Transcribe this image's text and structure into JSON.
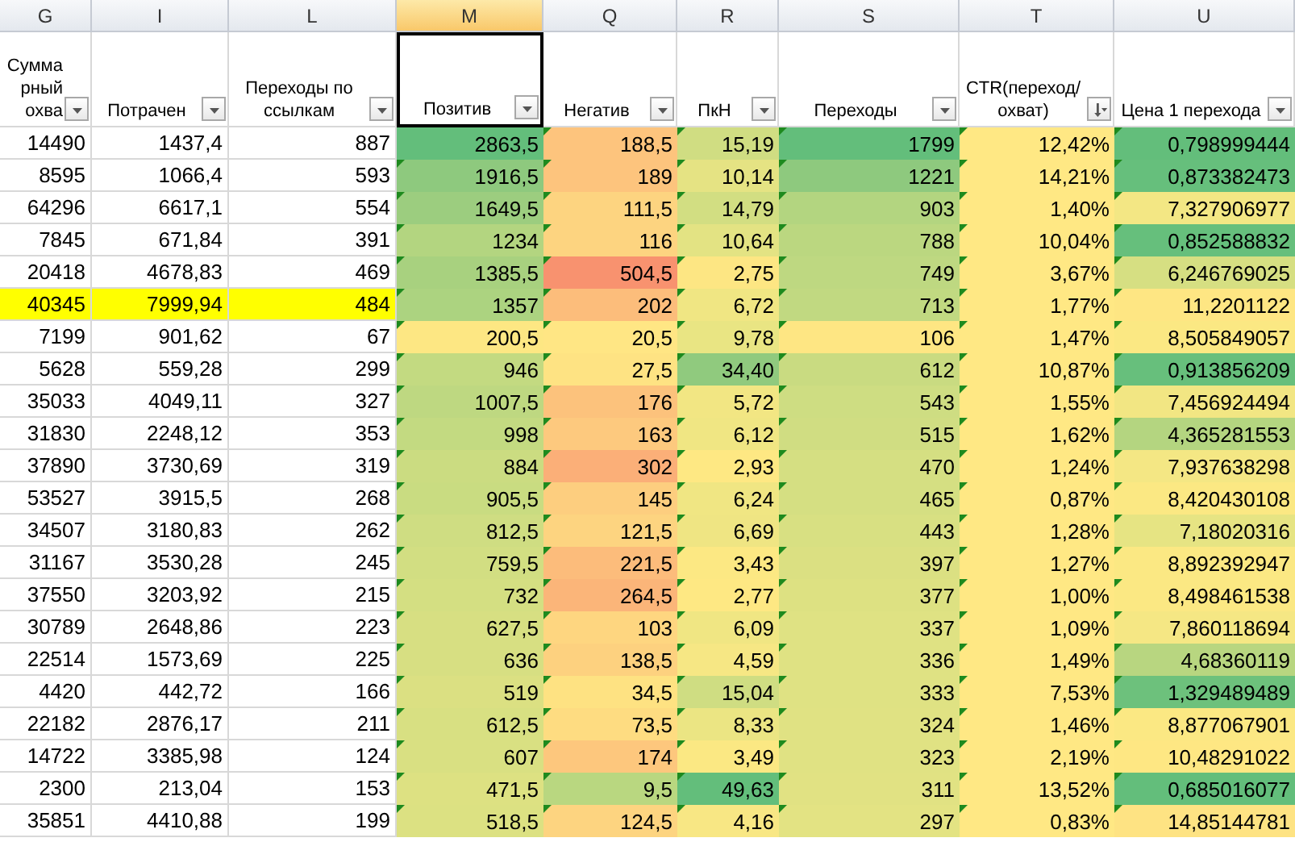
{
  "columns": [
    {
      "letter": "G",
      "header": "Суммарный охва",
      "sorted": false,
      "selected": false
    },
    {
      "letter": "I",
      "header": "Потрачен",
      "sorted": false,
      "selected": false
    },
    {
      "letter": "L",
      "header": "Переходы по ссылкам",
      "sorted": false,
      "selected": false
    },
    {
      "letter": "M",
      "header": "Позитив",
      "sorted": false,
      "selected": true
    },
    {
      "letter": "Q",
      "header": "Негатив",
      "sorted": false,
      "selected": false
    },
    {
      "letter": "R",
      "header": "ПкН",
      "sorted": false,
      "selected": false
    },
    {
      "letter": "S",
      "header": "Переходы",
      "sorted": false,
      "selected": false
    },
    {
      "letter": "T",
      "header": "CTR(переход/ охват)",
      "sorted": true,
      "selected": false
    },
    {
      "letter": "U",
      "header": "Цена 1 перехода",
      "sorted": false,
      "selected": false
    }
  ],
  "rows": [
    {
      "highlighted": false,
      "cells": [
        {
          "text": "14490"
        },
        {
          "text": "1437,4"
        },
        {
          "text": "887"
        },
        {
          "text": "2863,5",
          "color": "#63be7b",
          "flagged": false
        },
        {
          "text": "188,5",
          "color": "#fdc47d",
          "flagged": true
        },
        {
          "text": "15,19",
          "color": "#d0dd82",
          "flagged": true
        },
        {
          "text": "1799",
          "color": "#63be7b",
          "flagged": true
        },
        {
          "text": "12,42%",
          "color": "#ffe884",
          "flagged": true
        },
        {
          "text": "0,798999444",
          "color": "#63be7b",
          "flagged": true
        }
      ]
    },
    {
      "highlighted": false,
      "cells": [
        {
          "text": "8595"
        },
        {
          "text": "1066,4"
        },
        {
          "text": "593"
        },
        {
          "text": "1916,5",
          "color": "#8ec97e",
          "flagged": true
        },
        {
          "text": "189",
          "color": "#fdc47d",
          "flagged": true
        },
        {
          "text": "10,14",
          "color": "#e5e383",
          "flagged": true
        },
        {
          "text": "1221",
          "color": "#8ec97e",
          "flagged": true
        },
        {
          "text": "14,21%",
          "color": "#ffe884",
          "flagged": true
        },
        {
          "text": "0,873382473",
          "color": "#66bf7c",
          "flagged": true
        }
      ]
    },
    {
      "highlighted": false,
      "cells": [
        {
          "text": "64296"
        },
        {
          "text": "6617,1"
        },
        {
          "text": "554"
        },
        {
          "text": "1649,5",
          "color": "#9ccd7f",
          "flagged": true
        },
        {
          "text": "111,5",
          "color": "#fdd480",
          "flagged": true
        },
        {
          "text": "14,79",
          "color": "#d2de82",
          "flagged": true
        },
        {
          "text": "903",
          "color": "#b3d580",
          "flagged": true
        },
        {
          "text": "1,40%",
          "color": "#ffe884",
          "flagged": true
        },
        {
          "text": "7,327906977",
          "color": "#f3e784",
          "flagged": true
        }
      ]
    },
    {
      "highlighted": false,
      "cells": [
        {
          "text": "7845"
        },
        {
          "text": "671,84"
        },
        {
          "text": "391"
        },
        {
          "text": "1234",
          "color": "#b3d580",
          "flagged": true
        },
        {
          "text": "116",
          "color": "#fdd480",
          "flagged": true
        },
        {
          "text": "10,64",
          "color": "#e3e383",
          "flagged": true
        },
        {
          "text": "788",
          "color": "#bbd780",
          "flagged": true
        },
        {
          "text": "10,04%",
          "color": "#ffe884",
          "flagged": true
        },
        {
          "text": "0,852588832",
          "color": "#66bf7c",
          "flagged": true
        }
      ]
    },
    {
      "highlighted": false,
      "cells": [
        {
          "text": "20418"
        },
        {
          "text": "4678,83"
        },
        {
          "text": "469"
        },
        {
          "text": "1385,5",
          "color": "#a8d17f",
          "flagged": true
        },
        {
          "text": "504,5",
          "color": "#f8926f",
          "flagged": true
        },
        {
          "text": "2,75",
          "color": "#fde683",
          "flagged": true
        },
        {
          "text": "749",
          "color": "#bed881",
          "flagged": true
        },
        {
          "text": "3,67%",
          "color": "#ffe884",
          "flagged": true
        },
        {
          "text": "6,246769025",
          "color": "#d6df82",
          "flagged": true
        }
      ]
    },
    {
      "highlighted": true,
      "cells": [
        {
          "text": "40345"
        },
        {
          "text": "7999,94"
        },
        {
          "text": "484"
        },
        {
          "text": "1357",
          "color": "#acd380",
          "flagged": true
        },
        {
          "text": "202",
          "color": "#fcbd7b",
          "flagged": true
        },
        {
          "text": "6,72",
          "color": "#f0e683",
          "flagged": true
        },
        {
          "text": "713",
          "color": "#c1d981",
          "flagged": true
        },
        {
          "text": "1,77%",
          "color": "#ffe884",
          "flagged": true
        },
        {
          "text": "11,2201122",
          "color": "#fee683",
          "flagged": true
        }
      ]
    },
    {
      "highlighted": false,
      "cells": [
        {
          "text": "7199"
        },
        {
          "text": "901,62"
        },
        {
          "text": "67"
        },
        {
          "text": "200,5",
          "color": "#fde783",
          "flagged": true
        },
        {
          "text": "20,5",
          "color": "#ffe684",
          "flagged": true
        },
        {
          "text": "9,78",
          "color": "#e9e583",
          "flagged": true
        },
        {
          "text": "106",
          "color": "#fee683",
          "flagged": true
        },
        {
          "text": "1,47%",
          "color": "#ffe884",
          "flagged": true
        },
        {
          "text": "8,505849057",
          "color": "#fbe883",
          "flagged": true
        }
      ]
    },
    {
      "highlighted": false,
      "cells": [
        {
          "text": "5628"
        },
        {
          "text": "559,28"
        },
        {
          "text": "299"
        },
        {
          "text": "946",
          "color": "#c3da81",
          "flagged": true
        },
        {
          "text": "27,5",
          "color": "#fee383",
          "flagged": true
        },
        {
          "text": "34,40",
          "color": "#90ca7e",
          "flagged": true
        },
        {
          "text": "612",
          "color": "#c9db81",
          "flagged": true
        },
        {
          "text": "10,87%",
          "color": "#ffe884",
          "flagged": true
        },
        {
          "text": "0,913856209",
          "color": "#67bf7c",
          "flagged": true
        }
      ]
    },
    {
      "highlighted": false,
      "cells": [
        {
          "text": "35033"
        },
        {
          "text": "4049,11"
        },
        {
          "text": "327"
        },
        {
          "text": "1007,5",
          "color": "#bed881",
          "flagged": true
        },
        {
          "text": "176",
          "color": "#fcc27c",
          "flagged": true
        },
        {
          "text": "5,72",
          "color": "#f2e683",
          "flagged": true
        },
        {
          "text": "543",
          "color": "#cedd82",
          "flagged": true
        },
        {
          "text": "1,55%",
          "color": "#ffe884",
          "flagged": true
        },
        {
          "text": "7,456924494",
          "color": "#f2e683",
          "flagged": true
        }
      ]
    },
    {
      "highlighted": false,
      "cells": [
        {
          "text": "31830"
        },
        {
          "text": "2248,12"
        },
        {
          "text": "353"
        },
        {
          "text": "998",
          "color": "#c3da81",
          "flagged": true
        },
        {
          "text": "163",
          "color": "#fdc97e",
          "flagged": true
        },
        {
          "text": "6,12",
          "color": "#f0e683",
          "flagged": true
        },
        {
          "text": "515",
          "color": "#d0dd82",
          "flagged": true
        },
        {
          "text": "1,62%",
          "color": "#ffe884",
          "flagged": true
        },
        {
          "text": "4,365281553",
          "color": "#b4d580",
          "flagged": true
        }
      ]
    },
    {
      "highlighted": false,
      "cells": [
        {
          "text": "37890"
        },
        {
          "text": "3730,69"
        },
        {
          "text": "319"
        },
        {
          "text": "884",
          "color": "#cbdc81",
          "flagged": true
        },
        {
          "text": "302",
          "color": "#fbaf78",
          "flagged": true
        },
        {
          "text": "2,93",
          "color": "#fee883",
          "flagged": true
        },
        {
          "text": "470",
          "color": "#d5df82",
          "flagged": true
        },
        {
          "text": "1,24%",
          "color": "#ffe884",
          "flagged": true
        },
        {
          "text": "7,937638298",
          "color": "#f4e784",
          "flagged": true
        }
      ]
    },
    {
      "highlighted": false,
      "cells": [
        {
          "text": "53527"
        },
        {
          "text": "3915,5"
        },
        {
          "text": "268"
        },
        {
          "text": "905,5",
          "color": "#c9dc81",
          "flagged": true
        },
        {
          "text": "145",
          "color": "#fdce7f",
          "flagged": true
        },
        {
          "text": "6,24",
          "color": "#f0e683",
          "flagged": true
        },
        {
          "text": "465",
          "color": "#d5df82",
          "flagged": true
        },
        {
          "text": "0,87%",
          "color": "#ffe884",
          "flagged": true
        },
        {
          "text": "8,420430108",
          "color": "#fbe883",
          "flagged": true
        }
      ]
    },
    {
      "highlighted": false,
      "cells": [
        {
          "text": "34507"
        },
        {
          "text": "3180,83"
        },
        {
          "text": "262"
        },
        {
          "text": "812,5",
          "color": "#cfdd82",
          "flagged": true
        },
        {
          "text": "121,5",
          "color": "#fdd480",
          "flagged": true
        },
        {
          "text": "6,69",
          "color": "#efe583",
          "flagged": true
        },
        {
          "text": "443",
          "color": "#d8e082",
          "flagged": true
        },
        {
          "text": "1,28%",
          "color": "#ffe884",
          "flagged": true
        },
        {
          "text": "7,18020316",
          "color": "#e6e483",
          "flagged": true
        }
      ]
    },
    {
      "highlighted": false,
      "cells": [
        {
          "text": "31167"
        },
        {
          "text": "3530,28"
        },
        {
          "text": "245"
        },
        {
          "text": "759,5",
          "color": "#d2de82",
          "flagged": true
        },
        {
          "text": "221,5",
          "color": "#fcbc7b",
          "flagged": true
        },
        {
          "text": "3,43",
          "color": "#fce883",
          "flagged": true
        },
        {
          "text": "397",
          "color": "#dbe082",
          "flagged": true
        },
        {
          "text": "1,27%",
          "color": "#ffe884",
          "flagged": true
        },
        {
          "text": "8,892392947",
          "color": "#fbe883",
          "flagged": true
        }
      ]
    },
    {
      "highlighted": false,
      "cells": [
        {
          "text": "37550"
        },
        {
          "text": "3203,92"
        },
        {
          "text": "215"
        },
        {
          "text": "732",
          "color": "#d4df82",
          "flagged": true
        },
        {
          "text": "264,5",
          "color": "#fbb579",
          "flagged": true
        },
        {
          "text": "2,77",
          "color": "#fee883",
          "flagged": true
        },
        {
          "text": "377",
          "color": "#dde182",
          "flagged": true
        },
        {
          "text": "1,00%",
          "color": "#ffe884",
          "flagged": true
        },
        {
          "text": "8,498461538",
          "color": "#fbe883",
          "flagged": true
        }
      ]
    },
    {
      "highlighted": false,
      "cells": [
        {
          "text": "30789"
        },
        {
          "text": "2648,86"
        },
        {
          "text": "223"
        },
        {
          "text": "627,5",
          "color": "#d7df82",
          "flagged": true
        },
        {
          "text": "103",
          "color": "#fed680",
          "flagged": true
        },
        {
          "text": "6,09",
          "color": "#f0e683",
          "flagged": true
        },
        {
          "text": "337",
          "color": "#dfe283",
          "flagged": true
        },
        {
          "text": "1,09%",
          "color": "#ffe884",
          "flagged": true
        },
        {
          "text": "7,860118694",
          "color": "#f5e784",
          "flagged": true
        }
      ]
    },
    {
      "highlighted": false,
      "cells": [
        {
          "text": "22514"
        },
        {
          "text": "1573,69"
        },
        {
          "text": "225"
        },
        {
          "text": "636",
          "color": "#d7df82",
          "flagged": true
        },
        {
          "text": "138,5",
          "color": "#fdd17f",
          "flagged": true
        },
        {
          "text": "4,59",
          "color": "#f6e784",
          "flagged": true
        },
        {
          "text": "336",
          "color": "#dfe283",
          "flagged": true
        },
        {
          "text": "1,49%",
          "color": "#ffe884",
          "flagged": true
        },
        {
          "text": "4,68360119",
          "color": "#b8d680",
          "flagged": true
        }
      ]
    },
    {
      "highlighted": false,
      "cells": [
        {
          "text": "4420"
        },
        {
          "text": "442,72"
        },
        {
          "text": "166"
        },
        {
          "text": "519",
          "color": "#dbe082",
          "flagged": true
        },
        {
          "text": "34,5",
          "color": "#fee282",
          "flagged": true
        },
        {
          "text": "15,04",
          "color": "#cfdd82",
          "flagged": true
        },
        {
          "text": "333",
          "color": "#dfe283",
          "flagged": true
        },
        {
          "text": "7,53%",
          "color": "#ffe884",
          "flagged": true
        },
        {
          "text": "1,329489489",
          "color": "#6dc17c",
          "flagged": true
        }
      ]
    },
    {
      "highlighted": false,
      "cells": [
        {
          "text": "22182"
        },
        {
          "text": "2876,17"
        },
        {
          "text": "211"
        },
        {
          "text": "612,5",
          "color": "#d8e082",
          "flagged": true
        },
        {
          "text": "73,5",
          "color": "#fedc81",
          "flagged": true
        },
        {
          "text": "8,33",
          "color": "#ebe583",
          "flagged": true
        },
        {
          "text": "324",
          "color": "#e0e283",
          "flagged": true
        },
        {
          "text": "1,46%",
          "color": "#ffe884",
          "flagged": true
        },
        {
          "text": "8,877067901",
          "color": "#fbe883",
          "flagged": true
        }
      ]
    },
    {
      "highlighted": false,
      "cells": [
        {
          "text": "14722"
        },
        {
          "text": "3385,98"
        },
        {
          "text": "124"
        },
        {
          "text": "607",
          "color": "#d9e082",
          "flagged": true
        },
        {
          "text": "174",
          "color": "#fdc77d",
          "flagged": true
        },
        {
          "text": "3,49",
          "color": "#fbe883",
          "flagged": true
        },
        {
          "text": "323",
          "color": "#e0e283",
          "flagged": true
        },
        {
          "text": "2,19%",
          "color": "#ffe884",
          "flagged": true
        },
        {
          "text": "10,48291022",
          "color": "#fee783",
          "flagged": true
        }
      ]
    },
    {
      "highlighted": false,
      "cells": [
        {
          "text": "2300"
        },
        {
          "text": "213,04"
        },
        {
          "text": "153"
        },
        {
          "text": "471,5",
          "color": "#dde182",
          "flagged": true
        },
        {
          "text": "9,5",
          "color": "#b9d780",
          "flagged": true
        },
        {
          "text": "49,63",
          "color": "#63be7b",
          "flagged": true
        },
        {
          "text": "311",
          "color": "#e1e283",
          "flagged": true
        },
        {
          "text": "13,52%",
          "color": "#ffe884",
          "flagged": true
        },
        {
          "text": "0,685016077",
          "color": "#63be7b",
          "flagged": true
        }
      ]
    },
    {
      "highlighted": false,
      "cells": [
        {
          "text": "35851"
        },
        {
          "text": "4410,88"
        },
        {
          "text": "199"
        },
        {
          "text": "518,5",
          "color": "#dce182",
          "flagged": true
        },
        {
          "text": "124,5",
          "color": "#fdd480",
          "flagged": true
        },
        {
          "text": "4,16",
          "color": "#f8e784",
          "flagged": true
        },
        {
          "text": "297",
          "color": "#e3e383",
          "flagged": true
        },
        {
          "text": "0,83%",
          "color": "#ffe884",
          "flagged": true
        },
        {
          "text": "14,85144781",
          "color": "#fee383",
          "flagged": true
        }
      ]
    }
  ]
}
